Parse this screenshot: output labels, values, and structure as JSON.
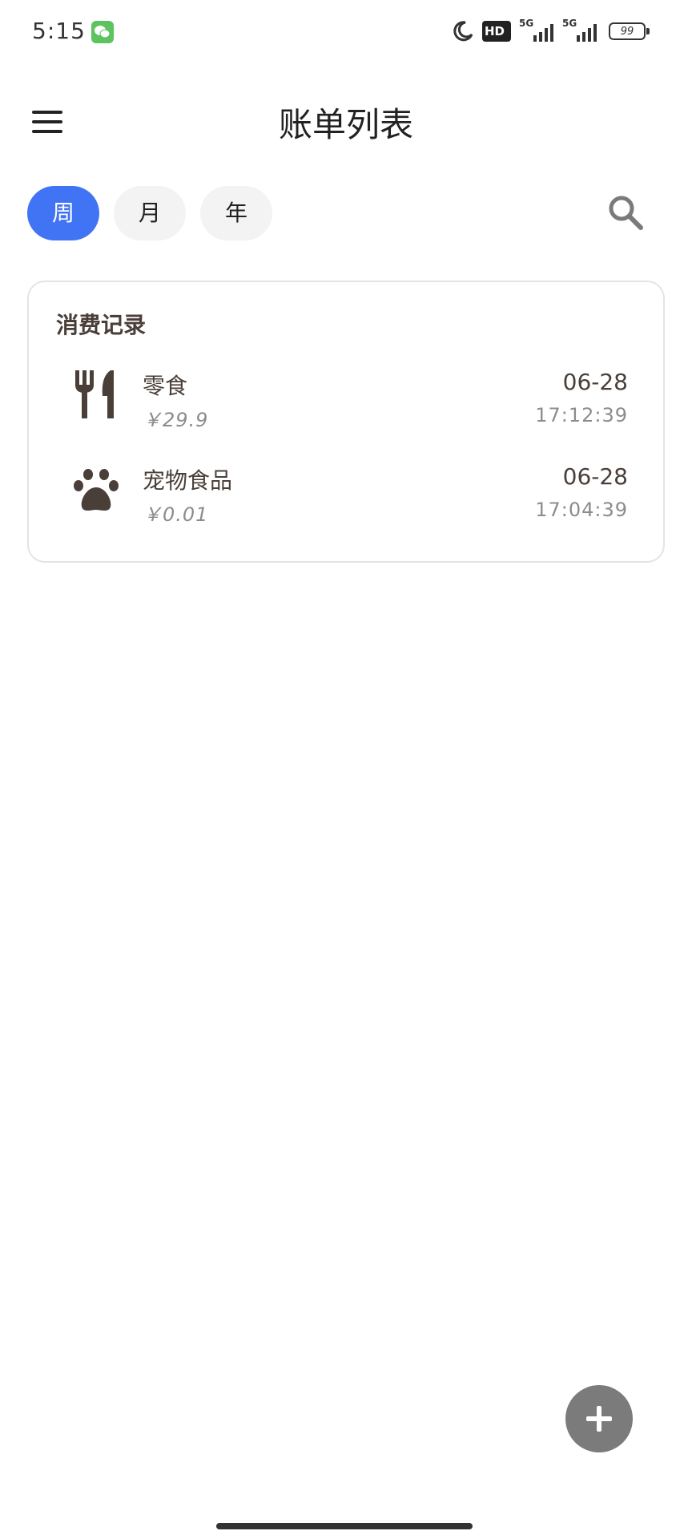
{
  "status_bar": {
    "time": "5:15",
    "hd_label": "HD",
    "network_1": "5G",
    "network_2": "5G",
    "battery": "99",
    "icons": [
      "wechat-icon",
      "moon-icon",
      "hd-icon",
      "signal-icon",
      "battery-icon"
    ]
  },
  "header": {
    "title": "账单列表",
    "menu_icon": "menu-icon"
  },
  "tabs": [
    {
      "label": "周",
      "active": true
    },
    {
      "label": "月",
      "active": false
    },
    {
      "label": "年",
      "active": false
    }
  ],
  "search_icon": "search-icon",
  "card": {
    "title": "消费记录",
    "records": [
      {
        "icon": "fork-knife-icon",
        "name": "零食",
        "amount": "￥29.9",
        "date": "06-28",
        "time": "17:12:39"
      },
      {
        "icon": "paw-icon",
        "name": "宠物食品",
        "amount": "￥0.01",
        "date": "06-28",
        "time": "17:04:39"
      }
    ]
  },
  "fab": {
    "icon": "plus-icon"
  },
  "colors": {
    "accent": "#4174f4",
    "text_brown": "#4a3f38",
    "fab": "#7b7b7b"
  }
}
